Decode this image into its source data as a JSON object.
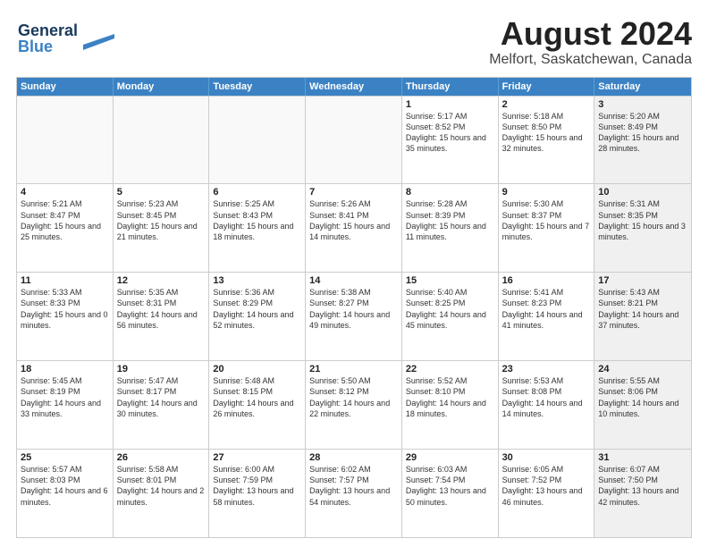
{
  "logo": {
    "line1": "General",
    "line2": "Blue"
  },
  "title": "August 2024",
  "subtitle": "Melfort, Saskatchewan, Canada",
  "days_of_week": [
    "Sunday",
    "Monday",
    "Tuesday",
    "Wednesday",
    "Thursday",
    "Friday",
    "Saturday"
  ],
  "weeks": [
    [
      {
        "day": "",
        "empty": true
      },
      {
        "day": "",
        "empty": true
      },
      {
        "day": "",
        "empty": true
      },
      {
        "day": "",
        "empty": true
      },
      {
        "day": "1",
        "sunrise": "5:17 AM",
        "sunset": "8:52 PM",
        "daylight": "15 hours and 35 minutes."
      },
      {
        "day": "2",
        "sunrise": "5:18 AM",
        "sunset": "8:50 PM",
        "daylight": "15 hours and 32 minutes."
      },
      {
        "day": "3",
        "sunrise": "5:20 AM",
        "sunset": "8:49 PM",
        "daylight": "15 hours and 28 minutes.",
        "shaded": true
      }
    ],
    [
      {
        "day": "4",
        "sunrise": "5:21 AM",
        "sunset": "8:47 PM",
        "daylight": "15 hours and 25 minutes."
      },
      {
        "day": "5",
        "sunrise": "5:23 AM",
        "sunset": "8:45 PM",
        "daylight": "15 hours and 21 minutes."
      },
      {
        "day": "6",
        "sunrise": "5:25 AM",
        "sunset": "8:43 PM",
        "daylight": "15 hours and 18 minutes."
      },
      {
        "day": "7",
        "sunrise": "5:26 AM",
        "sunset": "8:41 PM",
        "daylight": "15 hours and 14 minutes."
      },
      {
        "day": "8",
        "sunrise": "5:28 AM",
        "sunset": "8:39 PM",
        "daylight": "15 hours and 11 minutes."
      },
      {
        "day": "9",
        "sunrise": "5:30 AM",
        "sunset": "8:37 PM",
        "daylight": "15 hours and 7 minutes."
      },
      {
        "day": "10",
        "sunrise": "5:31 AM",
        "sunset": "8:35 PM",
        "daylight": "15 hours and 3 minutes.",
        "shaded": true
      }
    ],
    [
      {
        "day": "11",
        "sunrise": "5:33 AM",
        "sunset": "8:33 PM",
        "daylight": "15 hours and 0 minutes."
      },
      {
        "day": "12",
        "sunrise": "5:35 AM",
        "sunset": "8:31 PM",
        "daylight": "14 hours and 56 minutes."
      },
      {
        "day": "13",
        "sunrise": "5:36 AM",
        "sunset": "8:29 PM",
        "daylight": "14 hours and 52 minutes."
      },
      {
        "day": "14",
        "sunrise": "5:38 AM",
        "sunset": "8:27 PM",
        "daylight": "14 hours and 49 minutes."
      },
      {
        "day": "15",
        "sunrise": "5:40 AM",
        "sunset": "8:25 PM",
        "daylight": "14 hours and 45 minutes."
      },
      {
        "day": "16",
        "sunrise": "5:41 AM",
        "sunset": "8:23 PM",
        "daylight": "14 hours and 41 minutes."
      },
      {
        "day": "17",
        "sunrise": "5:43 AM",
        "sunset": "8:21 PM",
        "daylight": "14 hours and 37 minutes.",
        "shaded": true
      }
    ],
    [
      {
        "day": "18",
        "sunrise": "5:45 AM",
        "sunset": "8:19 PM",
        "daylight": "14 hours and 33 minutes."
      },
      {
        "day": "19",
        "sunrise": "5:47 AM",
        "sunset": "8:17 PM",
        "daylight": "14 hours and 30 minutes."
      },
      {
        "day": "20",
        "sunrise": "5:48 AM",
        "sunset": "8:15 PM",
        "daylight": "14 hours and 26 minutes."
      },
      {
        "day": "21",
        "sunrise": "5:50 AM",
        "sunset": "8:12 PM",
        "daylight": "14 hours and 22 minutes."
      },
      {
        "day": "22",
        "sunrise": "5:52 AM",
        "sunset": "8:10 PM",
        "daylight": "14 hours and 18 minutes."
      },
      {
        "day": "23",
        "sunrise": "5:53 AM",
        "sunset": "8:08 PM",
        "daylight": "14 hours and 14 minutes."
      },
      {
        "day": "24",
        "sunrise": "5:55 AM",
        "sunset": "8:06 PM",
        "daylight": "14 hours and 10 minutes.",
        "shaded": true
      }
    ],
    [
      {
        "day": "25",
        "sunrise": "5:57 AM",
        "sunset": "8:03 PM",
        "daylight": "14 hours and 6 minutes."
      },
      {
        "day": "26",
        "sunrise": "5:58 AM",
        "sunset": "8:01 PM",
        "daylight": "14 hours and 2 minutes."
      },
      {
        "day": "27",
        "sunrise": "6:00 AM",
        "sunset": "7:59 PM",
        "daylight": "13 hours and 58 minutes."
      },
      {
        "day": "28",
        "sunrise": "6:02 AM",
        "sunset": "7:57 PM",
        "daylight": "13 hours and 54 minutes."
      },
      {
        "day": "29",
        "sunrise": "6:03 AM",
        "sunset": "7:54 PM",
        "daylight": "13 hours and 50 minutes."
      },
      {
        "day": "30",
        "sunrise": "6:05 AM",
        "sunset": "7:52 PM",
        "daylight": "13 hours and 46 minutes."
      },
      {
        "day": "31",
        "sunrise": "6:07 AM",
        "sunset": "7:50 PM",
        "daylight": "13 hours and 42 minutes.",
        "shaded": true
      }
    ]
  ]
}
